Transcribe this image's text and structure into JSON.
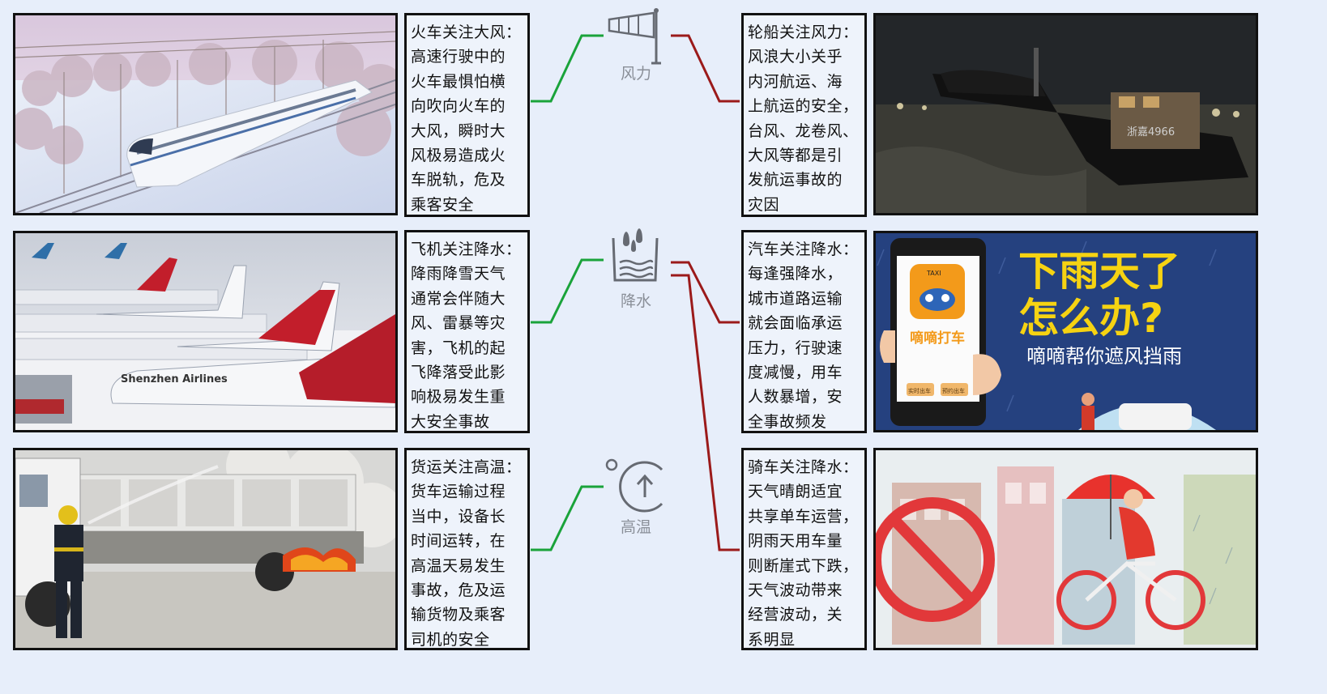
{
  "left_panels": [
    {
      "id": "train",
      "text": "火车关注大风：\n高速行驶中的\n火车最惧怕横\n向吹向火车的\n大风，瞬时大\n风极易造成火\n车脱轨，危及\n乘客安全"
    },
    {
      "id": "plane",
      "text": "飞机关注降水：\n降雨降雪天气\n通常会伴随大\n风、雷暴等灾\n害，飞机的起\n飞降落受此影\n响极易发生重\n大安全事故"
    },
    {
      "id": "truck",
      "text": "货运关注高温：\n货车运输过程\n当中，设备长\n时间运转，在\n高温天易发生\n事故，危及运\n输货物及乘客\n司机的安全"
    }
  ],
  "right_panels": [
    {
      "id": "ship",
      "text": "轮船关注风力：\n风浪大小关乎\n内河航运、海\n上航运的安全，\n台风、龙卷风、\n大风等都是引\n发航运事故的\n灾因"
    },
    {
      "id": "car",
      "text": "汽车关注降水：\n每逢强降水，\n城市道路运输\n就会面临承运\n压力，行驶速\n度减慢，用车\n人数暴增，安\n全事故频发"
    },
    {
      "id": "bike",
      "text": "骑车关注降水：\n天气晴朗适宜\n共享单车运营，\n阴雨天用车量\n则断崖式下跌，\n天气波动带来\n经营波动，关\n系明显"
    }
  ],
  "factors": [
    {
      "id": "wind",
      "label": "风力",
      "icon": "windsock-icon"
    },
    {
      "id": "rain",
      "label": "降水",
      "icon": "rain-gauge-icon"
    },
    {
      "id": "heat",
      "label": "高温",
      "icon": "thermometer-up-icon"
    }
  ],
  "photos": {
    "train": {
      "lettering": ""
    },
    "plane": {
      "lettering": "Shenzhen Airlines"
    },
    "truck": {
      "lettering": ""
    },
    "ship": {
      "lettering": "浙嘉4966"
    },
    "car": {
      "app_badge": "TAXI",
      "app_name": "嘀嘀打车",
      "headline": "下雨天了\n怎么办?",
      "sub": "嘀嘀帮你遮风挡雨",
      "buttons": [
        "预约出车",
        "实时出车"
      ]
    },
    "bike": {
      "lettering": ""
    }
  },
  "colors": {
    "green": "#1aa33a",
    "red": "#9b1a1a",
    "panel_bg": "#eef3fb",
    "page_bg": "#e7eefa"
  }
}
